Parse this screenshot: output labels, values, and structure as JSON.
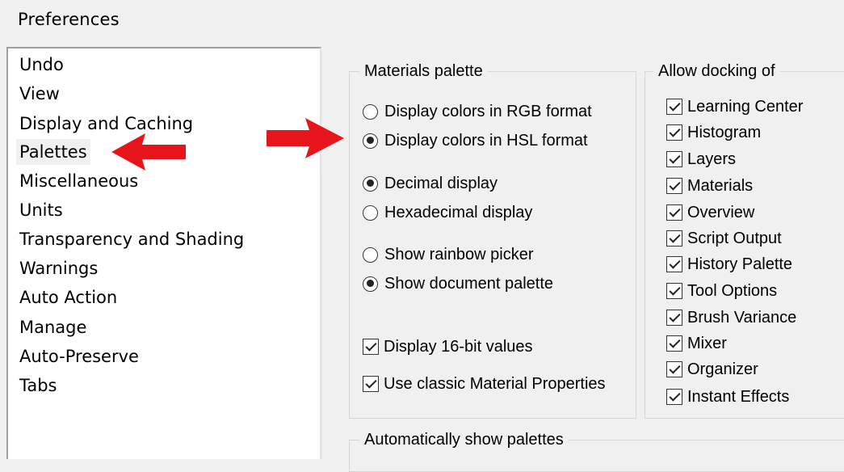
{
  "window": {
    "title": "Preferences"
  },
  "categories": [
    {
      "label": "Undo",
      "selected": false
    },
    {
      "label": "View",
      "selected": false
    },
    {
      "label": "Display and Caching",
      "selected": false
    },
    {
      "label": "Palettes",
      "selected": true
    },
    {
      "label": "Miscellaneous",
      "selected": false
    },
    {
      "label": "Units",
      "selected": false
    },
    {
      "label": "Transparency and Shading",
      "selected": false
    },
    {
      "label": "Warnings",
      "selected": false
    },
    {
      "label": "Auto Action",
      "selected": false
    },
    {
      "label": "Manage",
      "selected": false
    },
    {
      "label": "Auto-Preserve",
      "selected": false
    },
    {
      "label": "Tabs",
      "selected": false
    }
  ],
  "materials_palette": {
    "legend": "Materials palette",
    "color_format": [
      {
        "label": "Display colors in RGB format",
        "checked": false
      },
      {
        "label": "Display colors in HSL format",
        "checked": true
      }
    ],
    "number_format": [
      {
        "label": "Decimal display",
        "checked": true
      },
      {
        "label": "Hexadecimal display",
        "checked": false
      }
    ],
    "picker": [
      {
        "label": "Show rainbow picker",
        "checked": false
      },
      {
        "label": "Show document palette",
        "checked": true
      }
    ],
    "checkboxes": [
      {
        "label": "Display 16-bit values",
        "checked": true
      },
      {
        "label": "Use classic Material Properties",
        "checked": true
      }
    ]
  },
  "allow_docking": {
    "legend": "Allow docking of",
    "items": [
      {
        "label": "Learning Center",
        "checked": true
      },
      {
        "label": "Histogram",
        "checked": true
      },
      {
        "label": "Layers",
        "checked": true
      },
      {
        "label": "Materials",
        "checked": true
      },
      {
        "label": "Overview",
        "checked": true
      },
      {
        "label": "Script Output",
        "checked": true
      },
      {
        "label": "History Palette",
        "checked": true
      },
      {
        "label": "Tool Options",
        "checked": true
      },
      {
        "label": "Brush Variance",
        "checked": true
      },
      {
        "label": "Mixer",
        "checked": true
      },
      {
        "label": "Organizer",
        "checked": true
      },
      {
        "label": "Instant Effects",
        "checked": true
      }
    ]
  },
  "auto_show": {
    "legend": "Automatically show palettes"
  },
  "annotations": {
    "arrow_color": "#e8141b"
  }
}
